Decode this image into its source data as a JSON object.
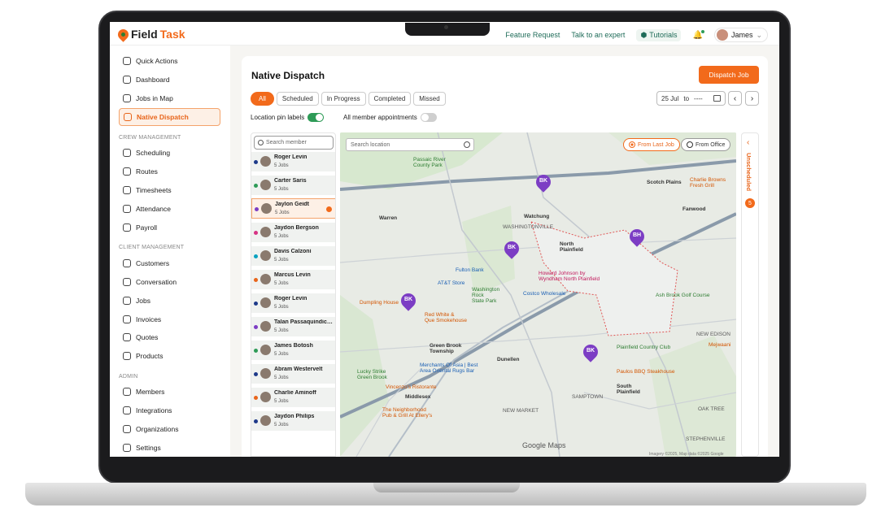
{
  "topbar": {
    "logo_prefix": "Field",
    "logo_suffix": "Task",
    "feature_request": "Feature Request",
    "talk_to_expert": "Talk to an expert",
    "tutorials": "Tutorials",
    "user_name": "James"
  },
  "sidebar": {
    "items": [
      {
        "label": "Quick Actions",
        "icon": "bolt-icon"
      },
      {
        "label": "Dashboard",
        "icon": "grid-icon"
      },
      {
        "label": "Jobs in Map",
        "icon": "map-icon"
      },
      {
        "label": "Native Dispatch",
        "icon": "dispatch-icon"
      },
      {
        "label": "Scheduling",
        "icon": "calendar-icon"
      },
      {
        "label": "Routes",
        "icon": "route-icon"
      },
      {
        "label": "Timesheets",
        "icon": "timesheet-icon"
      },
      {
        "label": "Attendance",
        "icon": "attendance-icon"
      },
      {
        "label": "Payroll",
        "icon": "payroll-icon"
      },
      {
        "label": "Customers",
        "icon": "customers-icon"
      },
      {
        "label": "Conversation",
        "icon": "chat-icon"
      },
      {
        "label": "Jobs",
        "icon": "jobs-icon"
      },
      {
        "label": "Invoices",
        "icon": "invoice-icon"
      },
      {
        "label": "Quotes",
        "icon": "quote-icon"
      },
      {
        "label": "Products",
        "icon": "products-icon"
      },
      {
        "label": "Members",
        "icon": "members-icon"
      },
      {
        "label": "Integrations",
        "icon": "integrations-icon"
      },
      {
        "label": "Organizations",
        "icon": "organizations-icon"
      },
      {
        "label": "Settings",
        "icon": "gear-icon"
      }
    ],
    "sections": {
      "crew": "CREW MANAGEMENT",
      "client": "CLIENT MANAGEMENT",
      "admin": "ADMIN"
    }
  },
  "main": {
    "title": "Native Dispatch",
    "dispatch_button": "Dispatch Job",
    "tabs": [
      "All",
      "Scheduled",
      "In Progress",
      "Completed",
      "Missed"
    ],
    "date_from": "25 Jul",
    "date_to_label": "to",
    "date_to": "----",
    "toggle_pin_labels": "Location pin labels",
    "toggle_member_appointments": "All member appointments"
  },
  "members": {
    "search_placeholder": "Search member",
    "list": [
      {
        "name": "Roger Levin",
        "jobs": "5 Jobs",
        "color": "#1e3a8a"
      },
      {
        "name": "Carter Saris",
        "jobs": "5 Jobs",
        "color": "#2e9b57"
      },
      {
        "name": "Jaylon Geidt",
        "jobs": "5 Jobs",
        "color": "#7c3dc4"
      },
      {
        "name": "Jaydon Bergson",
        "jobs": "5 Jobs",
        "color": "#d63384"
      },
      {
        "name": "Davis Calzoni",
        "jobs": "5 Jobs",
        "color": "#0aa2c0"
      },
      {
        "name": "Marcus Levin",
        "jobs": "5 Jobs",
        "color": "#e8651b"
      },
      {
        "name": "Roger Levin",
        "jobs": "5 Jobs",
        "color": "#1e3a8a"
      },
      {
        "name": "Talan Passaquindici...",
        "jobs": "5 Jobs",
        "color": "#7c3dc4"
      },
      {
        "name": "James Botosh",
        "jobs": "5 Jobs",
        "color": "#2e9b57"
      },
      {
        "name": "Abram Westervelt",
        "jobs": "5 Jobs",
        "color": "#1e3a8a"
      },
      {
        "name": "Charlie Aminoff",
        "jobs": "5 Jobs",
        "color": "#e8651b"
      },
      {
        "name": "Jaydon Philips",
        "jobs": "5 Jobs",
        "color": "#1e3a8a"
      }
    ]
  },
  "map": {
    "search_placeholder": "Search location",
    "from_last_job": "From Last Job",
    "from_office": "From Office",
    "google": "Google Maps",
    "attribution": "Imagery ©2025, Map data ©2025 Google",
    "pins": [
      "BK",
      "BK",
      "BH",
      "BK",
      "BK"
    ],
    "labels": {
      "passaic": "Passaic River\nCounty Park",
      "warren": "Warren",
      "watchung": "Watchung",
      "washingtonville": "WASHINGTONVILLE",
      "north_plainfield": "North\nPlainfield",
      "scotch_plains": "Scotch Plains",
      "fanwood": "Fanwood",
      "charlie_browns": "Charlie Browns\nFresh Grill",
      "fulton": "Fulton Bank",
      "att": "AT&T Store",
      "howard": "Howard Johnson by\nWyndham North Plainfield",
      "costco": "Costco Wholesale",
      "washington_rock": "Washington\nRock\nState Park",
      "dumpling": "Dumpling House",
      "red_white": "Red White &\nQue Smokehouse",
      "ash_brook": "Ash Brook Golf Course",
      "green_brook": "Green Brook\nTownship",
      "dunellen": "Dunellen",
      "plainfield_cc": "Plainfield Country Club",
      "new_edison": "NEW EDISON",
      "merchants": "Merchants Of Asia | Best\nArea Oriental Rugs Bar",
      "lucky_strike": "Lucky Strike\nGreen Brook",
      "middlesex": "Middlesex",
      "vincenzos": "Vincenzo's Ristorante",
      "paulos": "Paulos BBQ Steakhouse",
      "south_plainfield": "South\nPlainfield",
      "sampton": "SAMPTOWN",
      "neighborhood": "The Neighborhood\nPub & Grill At Ellery's",
      "new_market": "NEW MARKET",
      "oak_tree": "OAK TREE",
      "stephenville": "STEPHENVILLE",
      "melwani": "Mejwaani",
      "enterprise": "Enterprise",
      "fenwick": "Fanwood",
      "route22": "22"
    }
  },
  "unscheduled": {
    "label": "Unscheduled",
    "count": "5"
  }
}
